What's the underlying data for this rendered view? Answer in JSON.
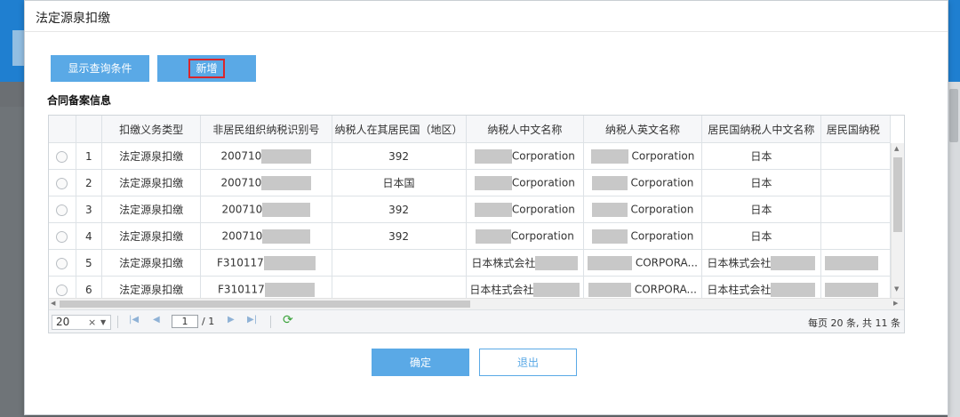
{
  "background": {
    "exit_text": "出"
  },
  "dialog": {
    "title": "法定源泉扣缴"
  },
  "toolbar": {
    "query_label": "显示查询条件",
    "add_label": "新增"
  },
  "section": {
    "title": "合同备案信息"
  },
  "table": {
    "columns": [
      "",
      "",
      "扣缴义务类型",
      "非居民组织纳税识别号",
      "纳税人在其居民国（地区）",
      "纳税人中文名称",
      "纳税人英文名称",
      "居民国纳税人中文名称",
      "居民国纳税"
    ],
    "rows": [
      {
        "no": "1",
        "type": "法定源泉扣缴",
        "tin": "200710",
        "country": "392",
        "cn_name": "Corporation",
        "en_name": "Corporation",
        "res_cn": "日本"
      },
      {
        "no": "2",
        "type": "法定源泉扣缴",
        "tin": "200710",
        "country": "日本国",
        "cn_name": "Corporation",
        "en_name": "Corporation",
        "res_cn": "日本"
      },
      {
        "no": "3",
        "type": "法定源泉扣缴",
        "tin": "200710",
        "country": "392",
        "cn_name": "Corporation",
        "en_name": "Corporation",
        "res_cn": "日本"
      },
      {
        "no": "4",
        "type": "法定源泉扣缴",
        "tin": "200710",
        "country": "392",
        "cn_name": "Corporation",
        "en_name": "Corporation",
        "res_cn": "日本"
      },
      {
        "no": "5",
        "type": "法定源泉扣缴",
        "tin": "F310117",
        "country": "",
        "cn_name": "日本株式会社",
        "en_name": "CORPORA...",
        "res_cn": "日本株式会社"
      },
      {
        "no": "6",
        "type": "法定源泉扣缴",
        "tin": "F310117",
        "country": "",
        "cn_name": "日本柱式会社",
        "en_name": "CORPORA...",
        "res_cn": "日本柱式会社"
      }
    ]
  },
  "pager": {
    "page_size": "20",
    "clear_glyph": "×",
    "dropdown_glyph": "▼",
    "current_page": "1",
    "total_pages": "/ 1",
    "first_glyph": "|◀",
    "prev_glyph": "◀",
    "next_glyph": "▶",
    "last_glyph": "▶|",
    "refresh_glyph": "⟳",
    "info": "每页 20 条, 共 11 条"
  },
  "footer": {
    "ok_label": "确定",
    "exit_label": "退出"
  }
}
